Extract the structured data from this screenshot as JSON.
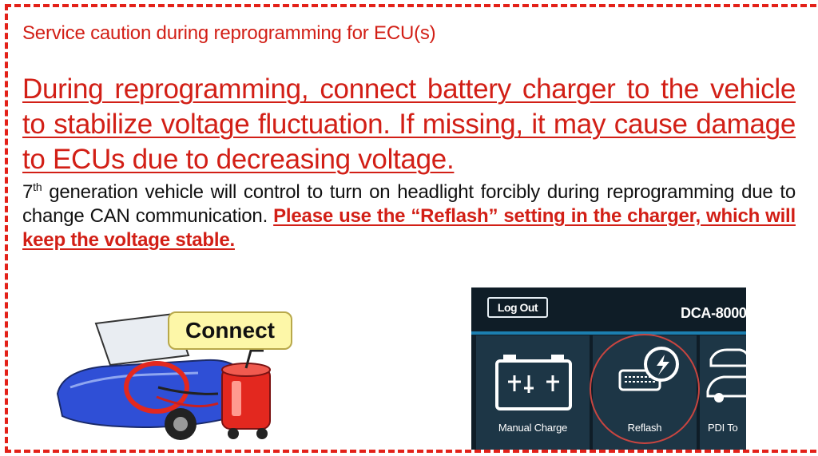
{
  "caution": {
    "subtitle": "Service caution during reprogramming for ECU(s)",
    "heading": "During reprogramming, connect battery charger to the vehicle to stabilize voltage fluctuation. If missing, it may cause damage to ECUs due to decreasing voltage.",
    "body_gen": "7",
    "body_sup": "th",
    "body_text": " generation vehicle will control to turn on headlight forcibly during reprogramming due to change CAN communication.  ",
    "body_emphasis": "Please use the “Reflash” setting in the charger, which will keep the voltage stable."
  },
  "illustration": {
    "connect_label": "Connect"
  },
  "charger_screen": {
    "logout_label": "Log Out",
    "model": "DCA-8000",
    "tiles": [
      {
        "label": "Manual Charge",
        "icon": "battery-icon"
      },
      {
        "label": "Reflash",
        "icon": "reflash-icon"
      },
      {
        "label": "PDI To",
        "icon": "car-icon"
      }
    ]
  },
  "colors": {
    "accent_red": "#d21f16",
    "frame_red": "#e32119",
    "screen_bg": "#0f1d27",
    "tile_bg": "#1d3646"
  }
}
